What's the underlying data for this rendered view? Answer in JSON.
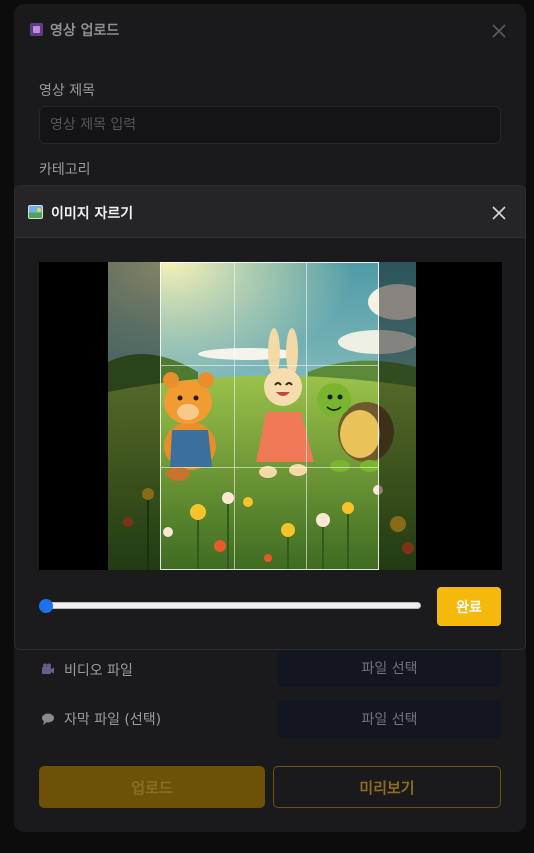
{
  "upload_modal": {
    "title": "영상 업로드",
    "title_icon": "clapper-icon",
    "close_icon": "close-icon",
    "video_title_label": "영상 제목",
    "video_title_placeholder": "영상 제목 입력",
    "video_title_value": "",
    "category_label": "카테고리",
    "video_file_icon": "camera-icon",
    "video_file_label": "비디오 파일",
    "video_file_button": "파일 선택",
    "subtitle_file_icon": "speech-bubble-icon",
    "subtitle_file_label": "자막 파일 (선택)",
    "subtitle_file_button": "파일 선택",
    "upload_button": "업로드",
    "preview_button": "미리보기"
  },
  "crop_modal": {
    "title": "이미지 자르기",
    "title_icon": "picture-icon",
    "close_icon": "close-icon",
    "image_description": "Cartoon bear, rabbit and turtle running through a flower meadow",
    "zoom_level": 0,
    "done_button": "완료"
  },
  "colors": {
    "accent": "#f5b90b",
    "slider_thumb": "#1a73e8",
    "modal_bg": "#1b1b1d",
    "page_bg": "#0c0c0d"
  }
}
